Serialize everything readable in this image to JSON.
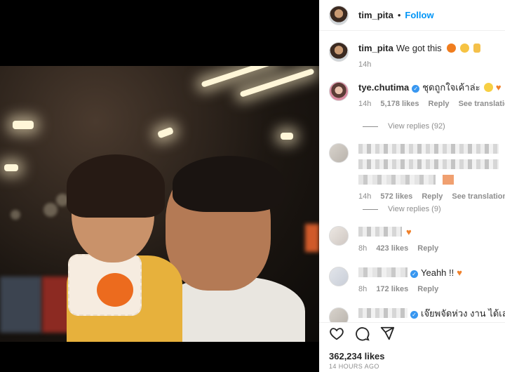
{
  "post": {
    "author": "tim_pita",
    "follow_label": "Follow",
    "header_dot": "•",
    "likes": "362,234 likes",
    "timestamp": "14 HOURS AGO"
  },
  "caption": {
    "username": "tim_pita",
    "text": "We got this",
    "emojis": [
      "orange",
      "flexed-biceps",
      "victory-hand"
    ],
    "time": "14h"
  },
  "comments": [
    {
      "username": "tye.chutima",
      "verified": true,
      "text": "ชุดถูกใจเค้าล่ะ",
      "time": "14h",
      "likes": "5,178 likes",
      "reply_label": "Reply",
      "translation_label": "See translation",
      "view_replies": "View replies (92)"
    },
    {
      "username": "",
      "verified": false,
      "text": "",
      "time": "14h",
      "likes": "572 likes",
      "reply_label": "Reply",
      "translation_label": "See translation",
      "view_replies": "View replies (9)"
    },
    {
      "username": "",
      "verified": false,
      "text": "",
      "time": "8h",
      "likes": "423 likes",
      "reply_label": "Reply"
    },
    {
      "username": "",
      "verified": true,
      "text": "Yeahh !!",
      "time": "8h",
      "likes": "172 likes",
      "reply_label": "Reply"
    },
    {
      "username": "",
      "verified": true,
      "text": "เจ๊ยพจัดห่วง งาน ได้เลยค่ะ",
      "time": "",
      "likes": "",
      "reply_label": ""
    }
  ],
  "icons": {
    "like": "heart-outline-icon",
    "comment": "comment-bubble-icon",
    "share": "paper-plane-icon"
  },
  "colors": {
    "accent": "#0095f6",
    "muted": "#8e8e8e",
    "heart_emoji": "#f0812b"
  }
}
